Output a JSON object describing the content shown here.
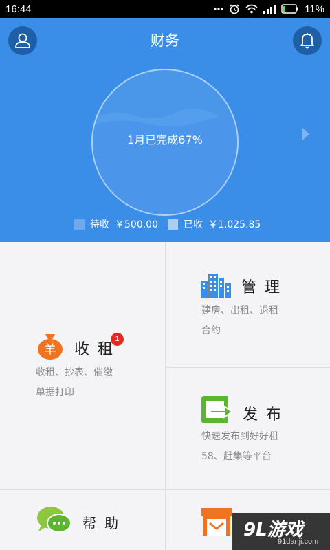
{
  "status_bar": {
    "time": "16:44",
    "battery": "11%"
  },
  "header": {
    "title": "财务",
    "progress_text": "1月已完成67%",
    "progress": 0.67,
    "legend": [
      {
        "label": "待收",
        "amount": "￥500.00"
      },
      {
        "label": "已收",
        "amount": "￥1,025.85"
      }
    ]
  },
  "tiles": {
    "rent": {
      "title": "收租",
      "badge": "1",
      "desc_line1": "收租、抄表、催缴",
      "desc_line2": "单据打印"
    },
    "manage": {
      "title": "管理",
      "desc_line1": "建房、出租、退租",
      "desc_line2": "合约"
    },
    "publish": {
      "title": "发布",
      "desc_line1": "快速发布到好好租",
      "desc_line2": "58、赶集等平台"
    },
    "help": {
      "title": "帮助"
    }
  },
  "watermark": {
    "text": "9L游戏",
    "sub": "91danji.com"
  },
  "colors": {
    "header_bg": "#3a8ee8",
    "accent_orange": "#f07420",
    "accent_green": "#5cb531"
  }
}
